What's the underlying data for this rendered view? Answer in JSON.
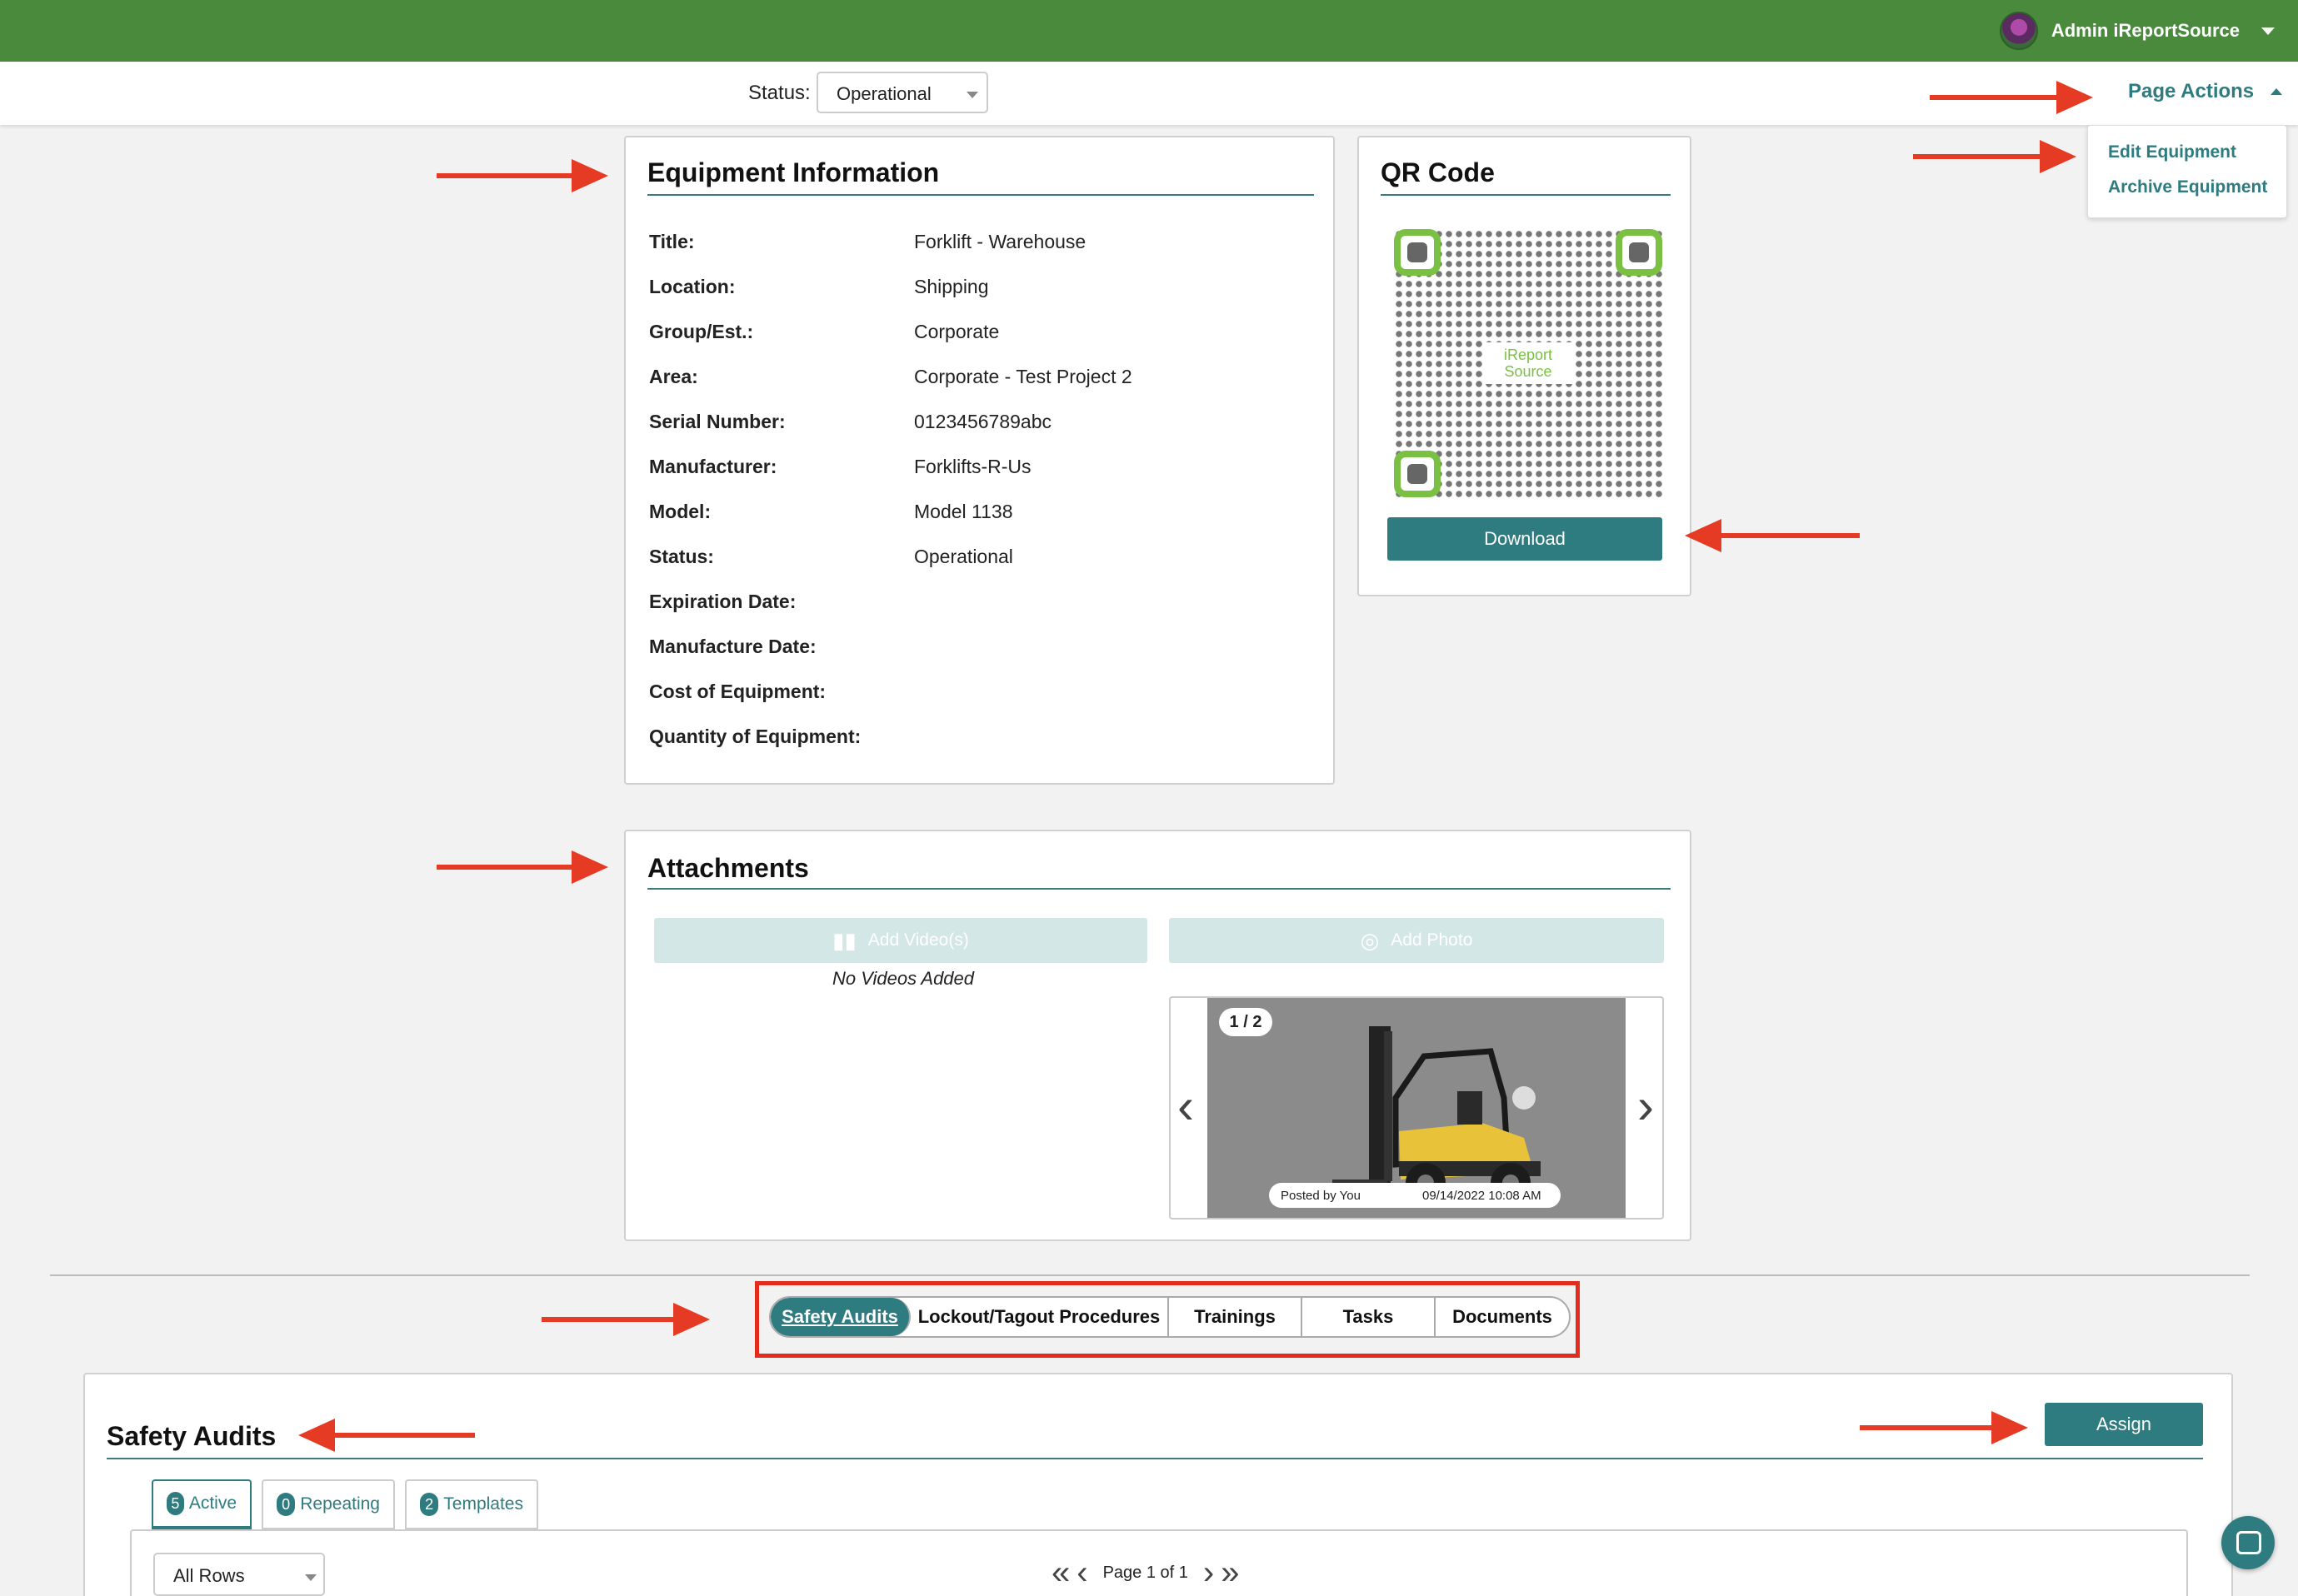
{
  "header": {
    "user_name": "Admin iReportSource",
    "status_label": "Status:",
    "status_value": "Operational",
    "page_actions": "Page Actions"
  },
  "page_actions_menu": {
    "items": [
      "Edit Equipment",
      "Archive Equipment"
    ]
  },
  "equipment_info": {
    "title": "Equipment Information",
    "fields": [
      {
        "label": "Title:",
        "value": "Forklift - Warehouse"
      },
      {
        "label": "Location:",
        "value": "Shipping"
      },
      {
        "label": "Group/Est.:",
        "value": "Corporate"
      },
      {
        "label": "Area:",
        "value": "Corporate - Test Project 2"
      },
      {
        "label": "Serial Number:",
        "value": "0123456789abc"
      },
      {
        "label": "Manufacturer:",
        "value": "Forklifts-R-Us"
      },
      {
        "label": "Model:",
        "value": "Model 1138"
      },
      {
        "label": "Status:",
        "value": "Operational"
      },
      {
        "label": "Expiration Date:",
        "value": ""
      },
      {
        "label": "Manufacture Date:",
        "value": ""
      },
      {
        "label": "Cost of Equipment:",
        "value": ""
      },
      {
        "label": "Quantity of Equipment:",
        "value": ""
      }
    ]
  },
  "qr_code": {
    "title": "QR Code",
    "logo_text": "iReport Source",
    "download_label": "Download"
  },
  "attachments": {
    "title": "Attachments",
    "add_video_label": "Add Video(s)",
    "add_photo_label": "Add Photo",
    "no_videos_text": "No Videos Added",
    "carousel": {
      "counter": "1 / 2",
      "posted_by": "Posted by You",
      "posted_date": "09/14/2022 10:08 AM"
    }
  },
  "tabs": {
    "items": [
      "Safety Audits",
      "Lockout/Tagout Procedures",
      "Trainings",
      "Tasks",
      "Documents"
    ],
    "active": "Safety Audits"
  },
  "safety_audits": {
    "title": "Safety Audits",
    "assign_label": "Assign",
    "subtabs": [
      {
        "count": "5",
        "label": "Active"
      },
      {
        "count": "0",
        "label": "Repeating"
      },
      {
        "count": "2",
        "label": "Templates"
      }
    ],
    "rows_select": "All Rows",
    "pager_text": "Page 1 of 1"
  },
  "icons": {
    "user_avatar": "avatar",
    "video": "video-icon",
    "camera": "camera-icon",
    "chat": "chat-icon"
  },
  "colors": {
    "topbar": "#4a8a3c",
    "accent": "#2e7b80",
    "annotation": "#e53a23"
  }
}
